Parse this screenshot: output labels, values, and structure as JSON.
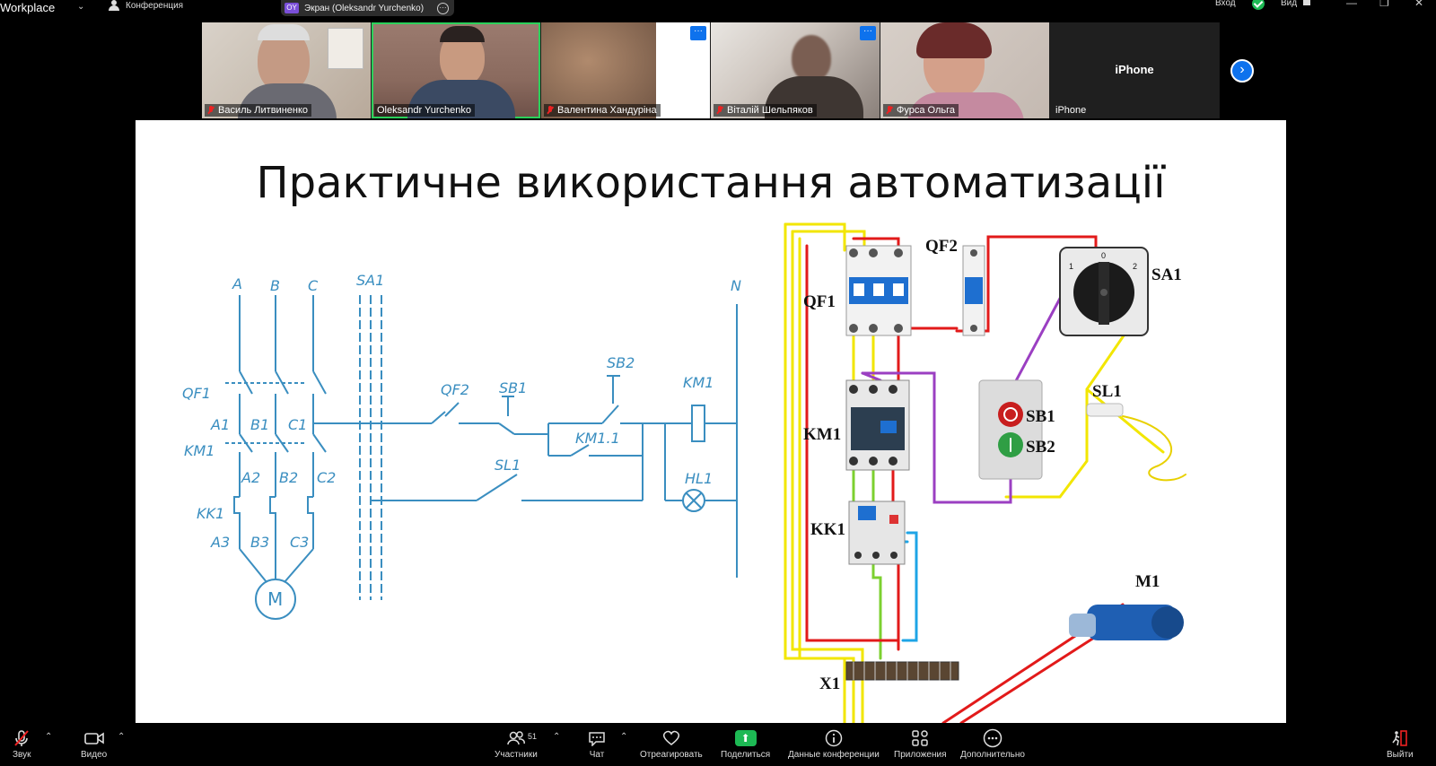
{
  "topbar": {
    "app_name": "Workplace",
    "meeting_label": "Конференция",
    "share_initials": "OY",
    "share_label": "Экран (Oleksandr Yurchenko)",
    "login_label": "Вход",
    "view_label": "Вид"
  },
  "participants": [
    {
      "name": "Василь Литвиненко",
      "muted": true
    },
    {
      "name": "Oleksandr Yurchenko",
      "muted": false,
      "active_speaker": true
    },
    {
      "name": "Валентина Хандуріна",
      "muted": true
    },
    {
      "name": "Віталій Шельпяков",
      "muted": true
    },
    {
      "name": "Фурса Ольга",
      "muted": true
    },
    {
      "name": "iPhone",
      "muted": false,
      "title": "iPhone"
    }
  ],
  "slide": {
    "title": "Практичне використання автоматизації",
    "schematic_labels": {
      "phases": [
        "A",
        "B",
        "C"
      ],
      "neutral": "N",
      "sa1": "SA1",
      "qf1": "QF1",
      "a1": "A1",
      "b1": "B1",
      "c1": "C1",
      "km1": "KM1",
      "a2": "A2",
      "b2": "B2",
      "c2": "C2",
      "kk1": "KK1",
      "a3": "A3",
      "b3": "B3",
      "c3": "C3",
      "motor": "M",
      "qf2": "QF2",
      "sb1": "SB1",
      "sb2": "SB2",
      "km11": "KM1.1",
      "sl1": "SL1",
      "km1_coil": "KM1",
      "hl1": "HL1"
    },
    "wiring_labels": {
      "qf1": "QF1",
      "qf2": "QF2",
      "sa1": "SA1",
      "km1": "KM1",
      "sb1": "SB1",
      "sb2": "SB2",
      "sl1": "SL1",
      "kk1": "KK1",
      "m1": "M1",
      "x1": "X1",
      "sa1_positions": [
        "1",
        "0",
        "2"
      ]
    }
  },
  "toolbar": {
    "audio": "Звук",
    "video": "Видео",
    "participants": "Участники",
    "participants_count": "51",
    "chat": "Чат",
    "react": "Отреагировать",
    "share": "Поделиться",
    "info": "Данные конференции",
    "apps": "Приложения",
    "more": "Дополнительно",
    "leave": "Выйти"
  },
  "colors": {
    "accent": "#0e72ed",
    "active_speaker": "#2bd15b",
    "share_green": "#1db954",
    "schematic_blue": "#3a8ec0"
  }
}
